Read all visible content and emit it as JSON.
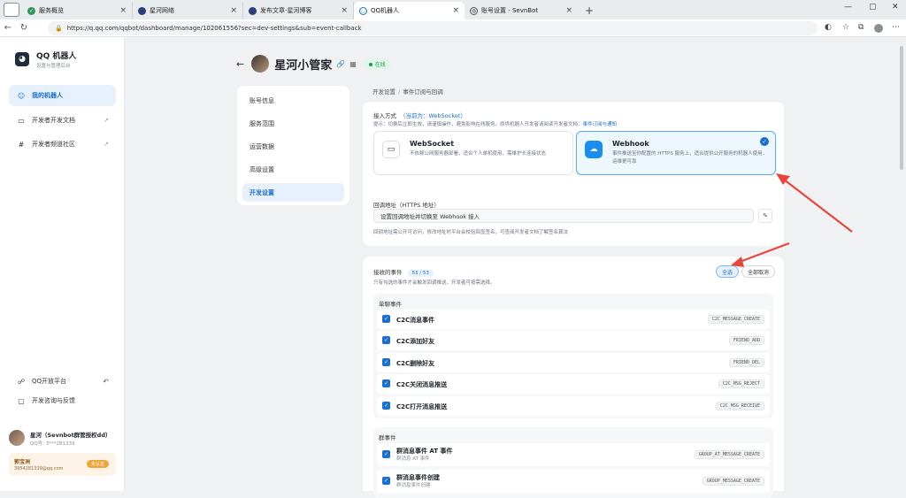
{
  "browser": {
    "tabs": [
      {
        "label": "服务概览",
        "icon": "shield-icon",
        "active": false
      },
      {
        "label": "星河网络",
        "icon": "site-icon",
        "active": false
      },
      {
        "label": "发布文章-星河博客",
        "icon": "site-icon",
        "active": false
      },
      {
        "label": "QQ机器人",
        "icon": "bot-icon",
        "active": true
      },
      {
        "label": "账号设置 - SevnBot",
        "icon": "globe-icon",
        "active": false
      }
    ],
    "url": "https://q.qq.com/qqbot/dashboard/manage/102061556?sec=dev-settings&sub=event-callback"
  },
  "sidebar": {
    "brand_title": "QQ 机器人",
    "brand_subtitle": "设置与管理后台",
    "nav": [
      {
        "label": "我的机器人",
        "icon": "robot-icon",
        "active": true,
        "external": false
      },
      {
        "label": "开发者开发文档",
        "icon": "book-icon",
        "active": false,
        "external": true
      },
      {
        "label": "开发者频道社区",
        "icon": "hash-icon",
        "active": false,
        "external": true
      }
    ],
    "bottom": [
      {
        "label": "QQ开放平台",
        "icon": "platform-icon"
      },
      {
        "label": "开发咨询与反馈",
        "icon": "chat-icon"
      }
    ],
    "user": {
      "name": "星河（Sevnbot群管授权dd）",
      "qq": "QQ号: 3***281339",
      "card_name": "郭宝洲",
      "card_email": "3954281339@qq.com",
      "card_badge": "未认证"
    }
  },
  "page": {
    "bot_name": "星河小管家",
    "status": "在线",
    "left_nav": [
      {
        "label": "账号信息",
        "active": false
      },
      {
        "label": "服务范围",
        "active": false
      },
      {
        "label": "运营数据",
        "active": false
      },
      {
        "label": "高级设置",
        "active": false
      },
      {
        "label": "开发设置",
        "active": true
      }
    ],
    "breadcrumb": [
      "开发设置",
      "事件订阅与回调"
    ]
  },
  "access": {
    "label": "接入方式",
    "current": "（当前为：WebSocket）",
    "hint": "提示：切换后立即生效，请谨慎操作，避免影响在线服务。原供机器人开发者请阅读开发者文档：",
    "hint_link": "事件订阅与通知",
    "options": [
      {
        "title": "WebSocket",
        "desc": "不依赖公网服务器部署，适合个人单机使用，需维护长连接状态",
        "selected": false,
        "icon": "monitor-icon"
      },
      {
        "title": "Webhook",
        "desc": "事件推送至你配置的 HTTPS 服务上，适合提供公开服务的机器人使用，运维更可靠",
        "selected": true,
        "icon": "cloud-icon"
      }
    ],
    "callback_label": "回调地址（HTTPS 地址）",
    "callback_value": "设置回调地址并切换至 Webhook 接入",
    "callback_hint": "回调地址需公开可访问，修改地址时平台会校验回显签名，可查阅开发者文档了解签名算法"
  },
  "events": {
    "label": "接收的事件",
    "count": "53 / 53",
    "hint": "只有勾选的事件才会触发回调推送，开发者可按需选择。",
    "select_all": "全选",
    "clear_all": "全部取消",
    "groups": [
      {
        "title": "单聊事件",
        "items": [
          {
            "name": "C2C消息事件",
            "code": "C2C_MESSAGE_CREATE",
            "sub": ""
          },
          {
            "name": "C2C添加好友",
            "code": "FRIEND_ADD",
            "sub": ""
          },
          {
            "name": "C2C删除好友",
            "code": "FRIEND_DEL",
            "sub": ""
          },
          {
            "name": "C2C关闭消息推送",
            "code": "C2C_MSG_REJECT",
            "sub": ""
          },
          {
            "name": "C2C打开消息推送",
            "code": "C2C_MSG_RECEIVE",
            "sub": ""
          }
        ]
      },
      {
        "title": "群事件",
        "items": [
          {
            "name": "群消息事件 AT 事件",
            "code": "GROUP_AT_MESSAGE_CREATE",
            "sub": "群消息 AT 事件"
          },
          {
            "name": "群消息事件创建",
            "code": "GROUP_MESSAGE_CREATE",
            "sub": "群消息事件创建"
          }
        ]
      }
    ]
  },
  "colors": {
    "accent": "#1a6fd3",
    "arrow": "#e8453c",
    "online": "#1c9b4a"
  }
}
